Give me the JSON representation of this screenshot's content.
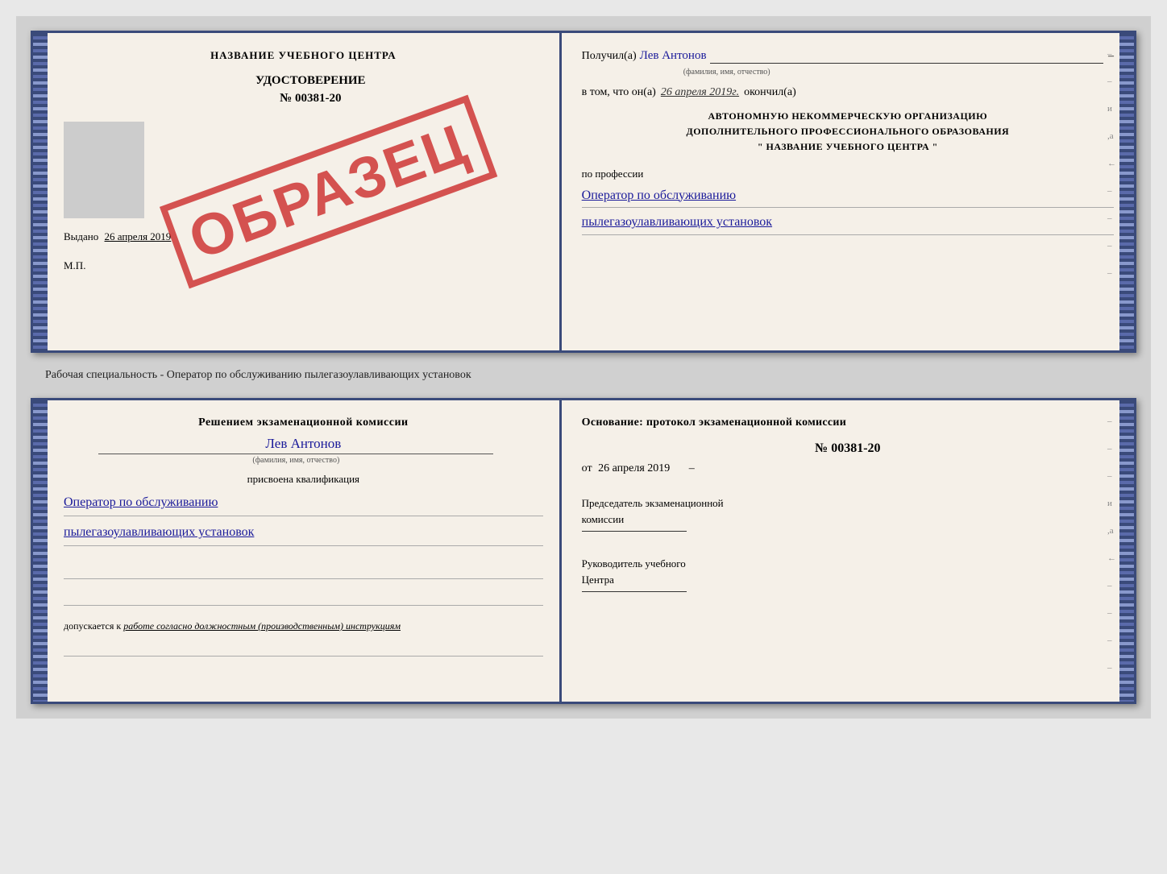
{
  "top_cert": {
    "left": {
      "school_name": "НАЗВАНИЕ УЧЕБНОГО ЦЕНТРА",
      "udostoverenie_label": "УДОСТОВЕРЕНИЕ",
      "udostoverenie_number": "№ 00381-20",
      "vydano_prefix": "Выдано",
      "vydano_date": "26 апреля 2019",
      "mp_label": "М.П.",
      "stamp_text": "ОБРАЗЕЦ"
    },
    "right": {
      "poluchil_prefix": "Получил(а)",
      "recipient_name": "Лев Антонов",
      "fio_subtitle": "(фамилия, имя, отчество)",
      "vtom_prefix": "в том, что он(а)",
      "vtom_date": "26 апреля 2019г.",
      "okonchil": "окончил(а)",
      "org_line1": "АВТОНОМНУЮ НЕКОММЕРЧЕСКУЮ ОРГАНИЗАЦИЮ",
      "org_line2": "ДОПОЛНИТЕЛЬНОГО ПРОФЕССИОНАЛЬНОГО ОБРАЗОВАНИЯ",
      "org_line3": "\" НАЗВАНИЕ УЧЕБНОГО ЦЕНТРА \"",
      "po_professii_label": "по профессии",
      "profession_line1": "Оператор по обслуживанию",
      "profession_line2": "пылегазоулавливающих установок"
    }
  },
  "middle_text": "Рабочая специальность - Оператор по обслуживанию пылегазоулавливающих установок",
  "bottom_cert": {
    "left": {
      "resheniem_text": "Решением экзаменационной комиссии",
      "fio_name": "Лев Антонов",
      "fio_subtitle": "(фамилия, имя, отчество)",
      "prisvoena_text": "присвоена квалификация",
      "kvalif_line1": "Оператор по обслуживанию",
      "kvalif_line2": "пылегазоулавливающих установок",
      "dopuskaetsya_prefix": "допускается к",
      "dopuskaetsya_italic": "работе согласно должностным (производственным) инструкциям"
    },
    "right": {
      "osnovanie_text": "Основание: протокол экзаменационной комиссии",
      "protocol_number": "№ 00381-20",
      "ot_prefix": "от",
      "ot_date": "26 апреля 2019",
      "predsedatel_line1": "Председатель экзаменационной",
      "predsedatel_line2": "комиссии",
      "rukovoditel_line1": "Руководитель учебного",
      "rukovoditel_line2": "Центра"
    }
  }
}
